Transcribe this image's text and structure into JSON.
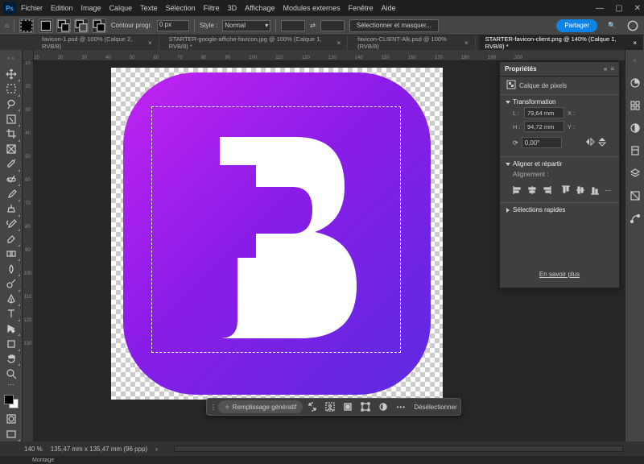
{
  "menu": [
    "Fichier",
    "Edition",
    "Image",
    "Calque",
    "Texte",
    "Sélection",
    "Filtre",
    "3D",
    "Affichage",
    "Modules externes",
    "Fenêtre",
    "Aide"
  ],
  "options": {
    "contour_label": "Contour progr.",
    "contour_value": "0 px",
    "style_label": "Style :",
    "style_value": "Normal",
    "select_mask": "Sélectionner et masquer..."
  },
  "share": "Partager",
  "tabs": [
    {
      "label": "favicon-1.psd @ 100% (Calque 2, RVB/8)"
    },
    {
      "label": "STARTER-google-affiche-favicon.jpg @ 100% (Calque 1, RVB/8) *"
    },
    {
      "label": "favicon-CLIENT-Alk.psd @ 100% (RVB/8)"
    },
    {
      "label": "STARTER-favicon-client.png @ 140% (Calque 1, RVB/8) *"
    }
  ],
  "ruler_h": [
    "10",
    "20",
    "30",
    "40",
    "50",
    "60",
    "70",
    "80",
    "90",
    "100",
    "110",
    "120",
    "130",
    "140",
    "150",
    "160",
    "170",
    "180",
    "190",
    "200"
  ],
  "ruler_v": [
    "10",
    "20",
    "30",
    "40",
    "50",
    "60",
    "70",
    "80",
    "90",
    "100",
    "110",
    "120",
    "130"
  ],
  "ctx": {
    "genfill": "Remplissage génératif",
    "deselect": "Désélectionner"
  },
  "panel": {
    "title": "Propriétés",
    "pixel_layer": "Calque de pixels",
    "transform_title": "Transformation",
    "width_value": "79,64 mm",
    "height_value": "94,72 mm",
    "x_label": "X :",
    "y_label": "Y :",
    "angle_value": "0,00°",
    "align_title": "Aligner et répartir",
    "align_label": "Alignement :",
    "quick_title": "Sélections rapides",
    "more_link": "En savoir plus"
  },
  "status": {
    "zoom": "140 %",
    "doc": "135,47 mm x 135,47 mm (96 ppp)"
  },
  "montage": "Montage"
}
